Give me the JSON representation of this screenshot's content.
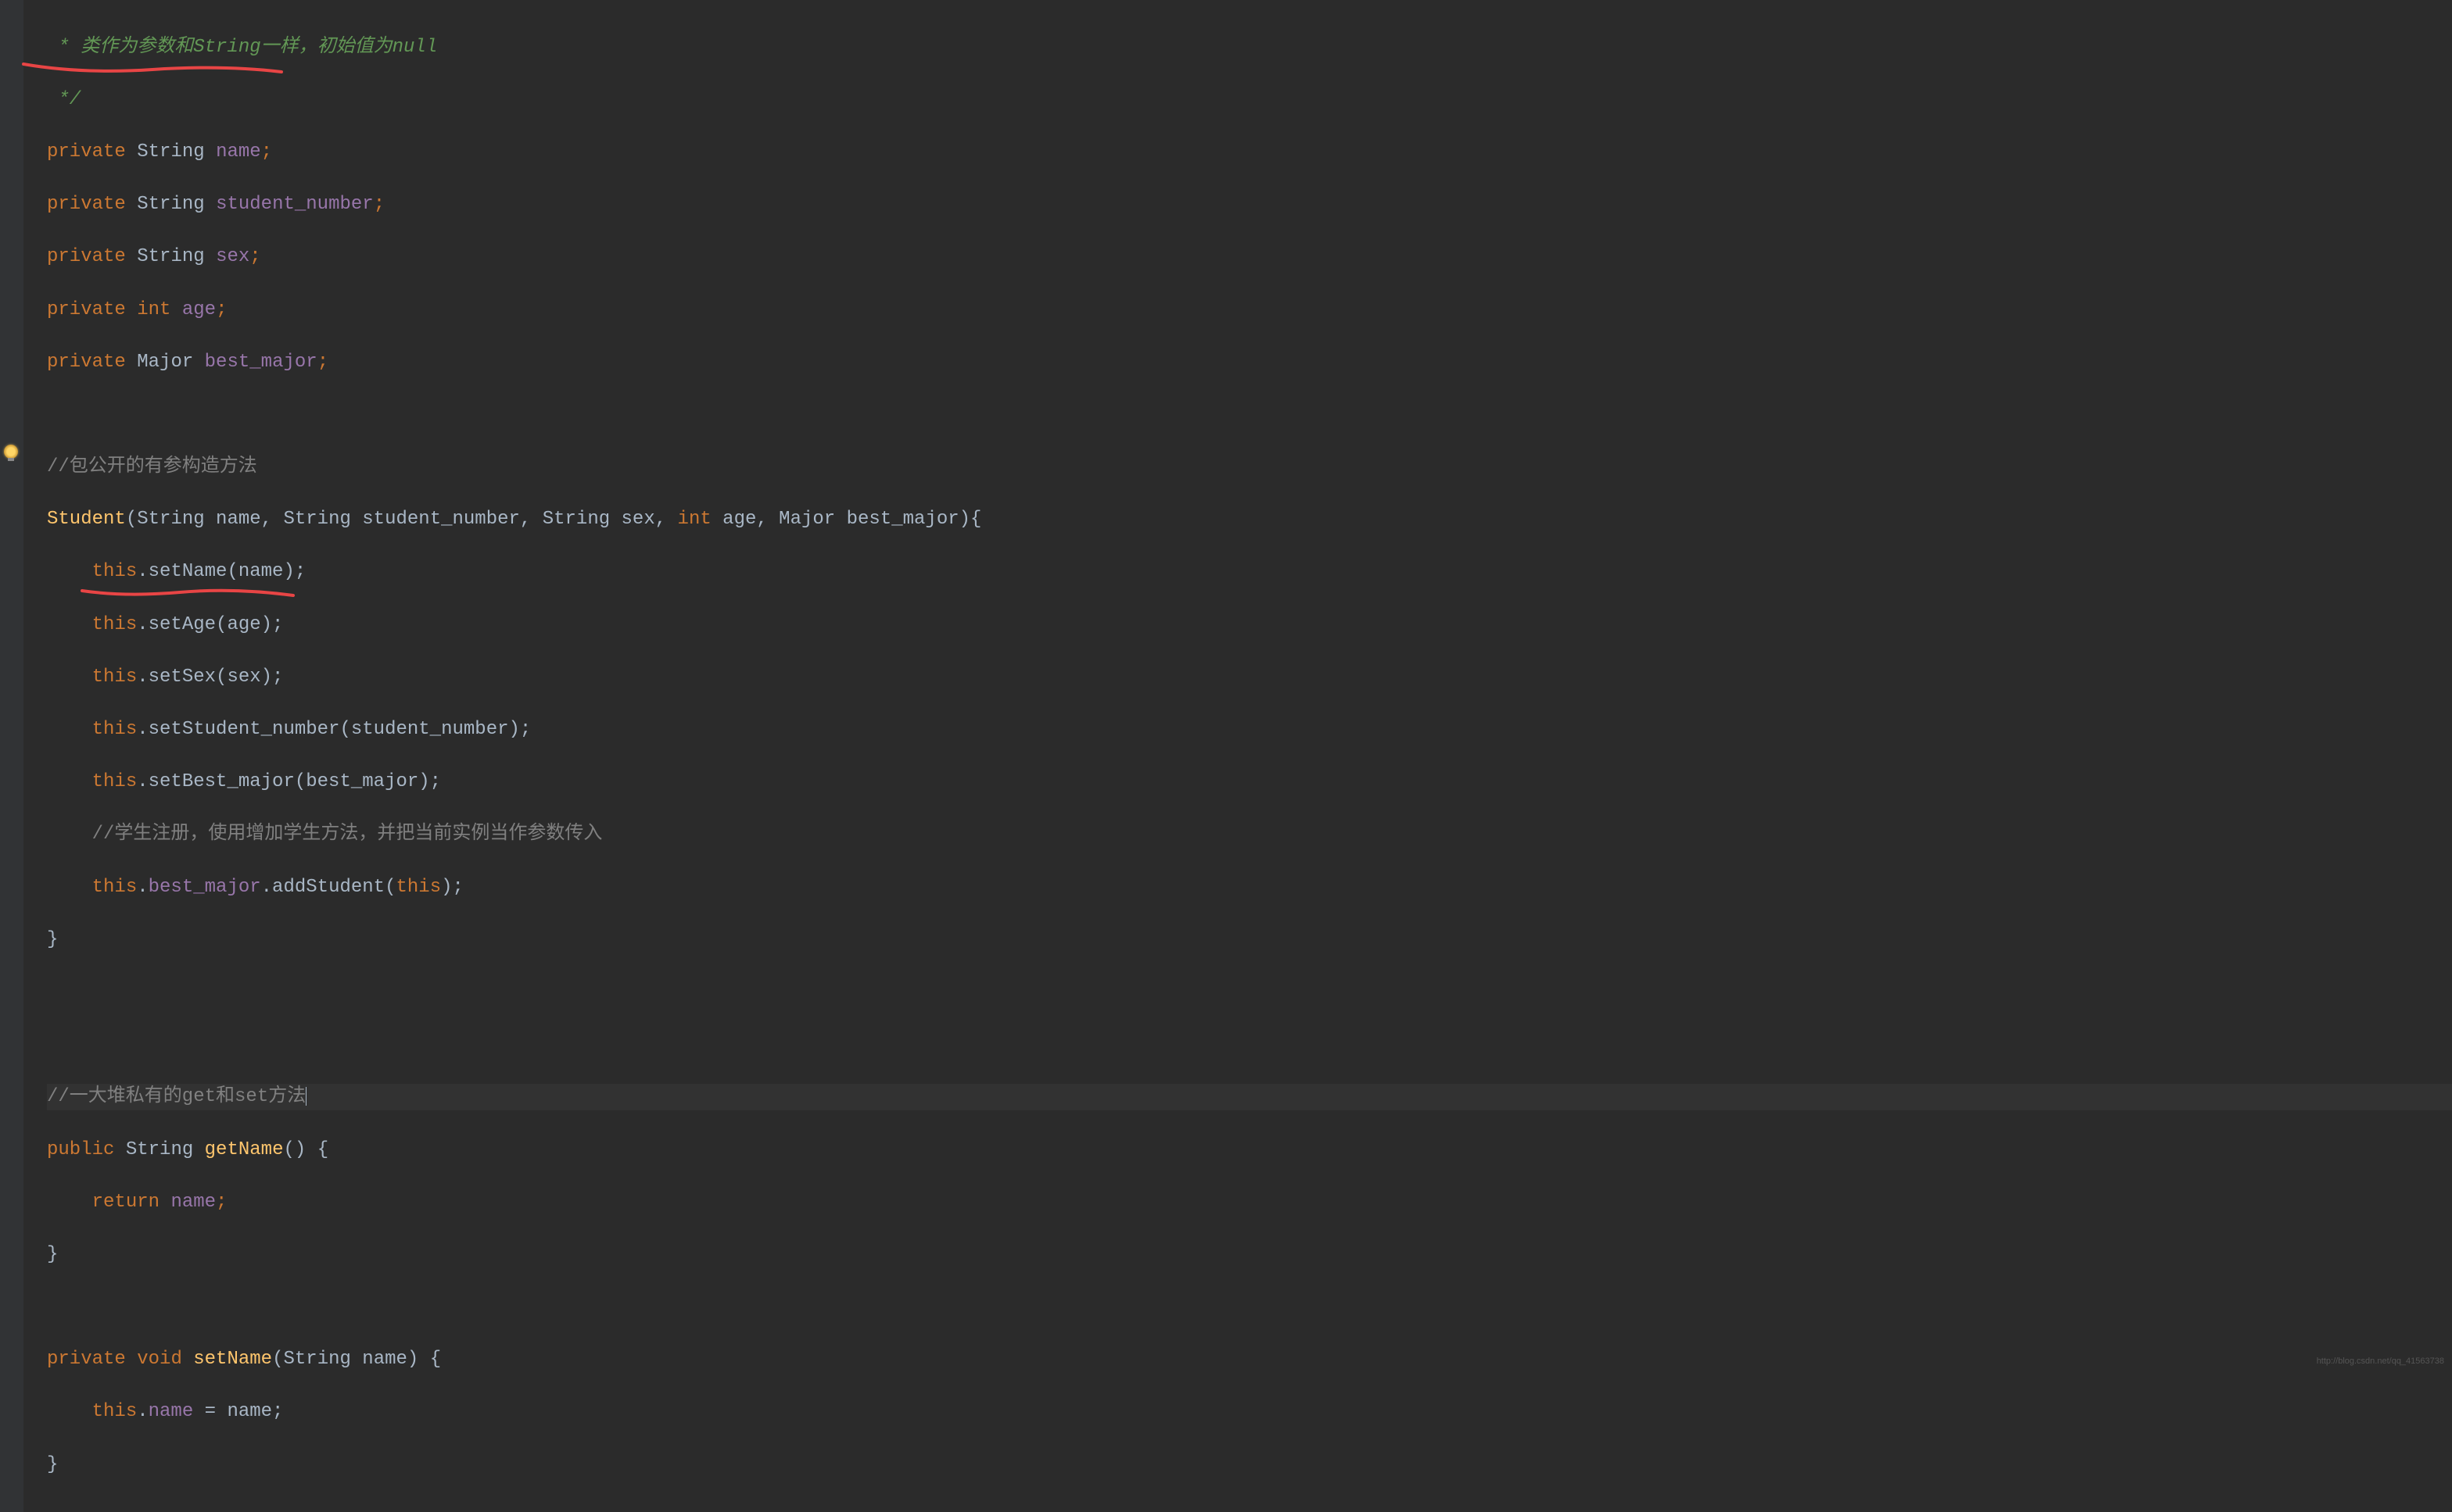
{
  "comment1_prefix": " * ",
  "comment1_text": "类作为参数和String一样，初始值为null",
  "comment1_end": " */",
  "line3": {
    "private": "private",
    "type": "String",
    "name": "name",
    "semi": ";"
  },
  "line4": {
    "private": "private",
    "type": "String",
    "name": "student_number",
    "semi": ";"
  },
  "line5": {
    "private": "private",
    "type": "String",
    "name": "sex",
    "semi": ";"
  },
  "line6": {
    "private": "private",
    "type": "int",
    "name": "age",
    "semi": ";"
  },
  "line7": {
    "private": "private",
    "type": "Major",
    "name": "best_major",
    "semi": ";"
  },
  "comment2": "//包公开的有参构造方法",
  "constructor": {
    "name": "Student",
    "params": "(String name, String student_number, String sex, ",
    "int_kw": "int",
    "params2": " age, Major best_major){"
  },
  "body": {
    "l1a": "this",
    "l1b": ".setName(name);",
    "l2a": "this",
    "l2b": ".setAge(age);",
    "l3a": "this",
    "l3b": ".setSex(sex);",
    "l4a": "this",
    "l4b": ".setStudent_number(student_number);",
    "l5a": "this",
    "l5b": ".setBest_major(best_major);",
    "comment": "//学生注册，使用增加学生方法，并把当前实例当作参数传入",
    "l6a": "this",
    "l6b": ".",
    "l6c": "best_major",
    "l6d": ".addStudent(",
    "l6e": "this",
    "l6f": ");"
  },
  "close_brace": "}",
  "comment3": "//一大堆私有的get和set方法",
  "getName": {
    "public": "public",
    "type": "String",
    "method": "getName",
    "params": "() {",
    "return": "return",
    "name": "name",
    "semi": ";",
    "close": "}"
  },
  "setName": {
    "private": "private",
    "void": "void",
    "method": "setName",
    "params": "(String name) {",
    "this": "this",
    "dot": ".",
    "field": "name",
    "eq": " = name;",
    "close": "}"
  },
  "watermark": "http://blog.csdn.net/qq_41563738"
}
